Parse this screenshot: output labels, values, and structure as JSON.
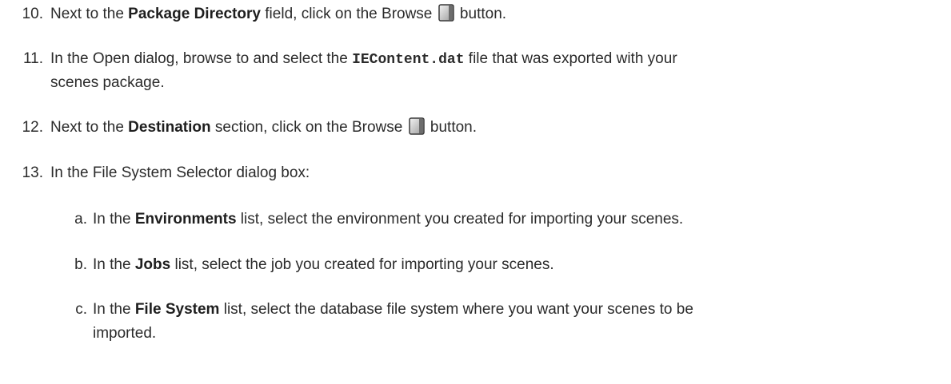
{
  "steps": [
    {
      "num": "10.",
      "t1": "Next to the ",
      "b1": "Package Directory",
      "t2": " field, click on the Browse ",
      "t3": " button.",
      "icon": "browse-icon"
    },
    {
      "num": "11.",
      "t1": "In the Open dialog, browse to and select the ",
      "code1": "IEContent.dat",
      "t2": " file that was exported with your",
      "t3": "scenes package."
    },
    {
      "num": "12.",
      "t1": "Next to the ",
      "b1": "Destination",
      "t2": " section, click on the Browse ",
      "t3": " button.",
      "icon": "browse-icon"
    },
    {
      "num": "13.",
      "t1": "In the File System Selector dialog box:"
    }
  ],
  "substeps": [
    {
      "letter": "a.",
      "t1": "In the ",
      "b1": "Environments",
      "t2": " list, select the environment you created for importing your scenes."
    },
    {
      "letter": "b.",
      "t1": "In the ",
      "b1": "Jobs",
      "t2": " list, select the job you created for importing your scenes."
    },
    {
      "letter": "c.",
      "t1": "In the ",
      "b1": "File System",
      "t2": " list, select the database file system where you want your scenes to be",
      "t3": "imported."
    }
  ]
}
